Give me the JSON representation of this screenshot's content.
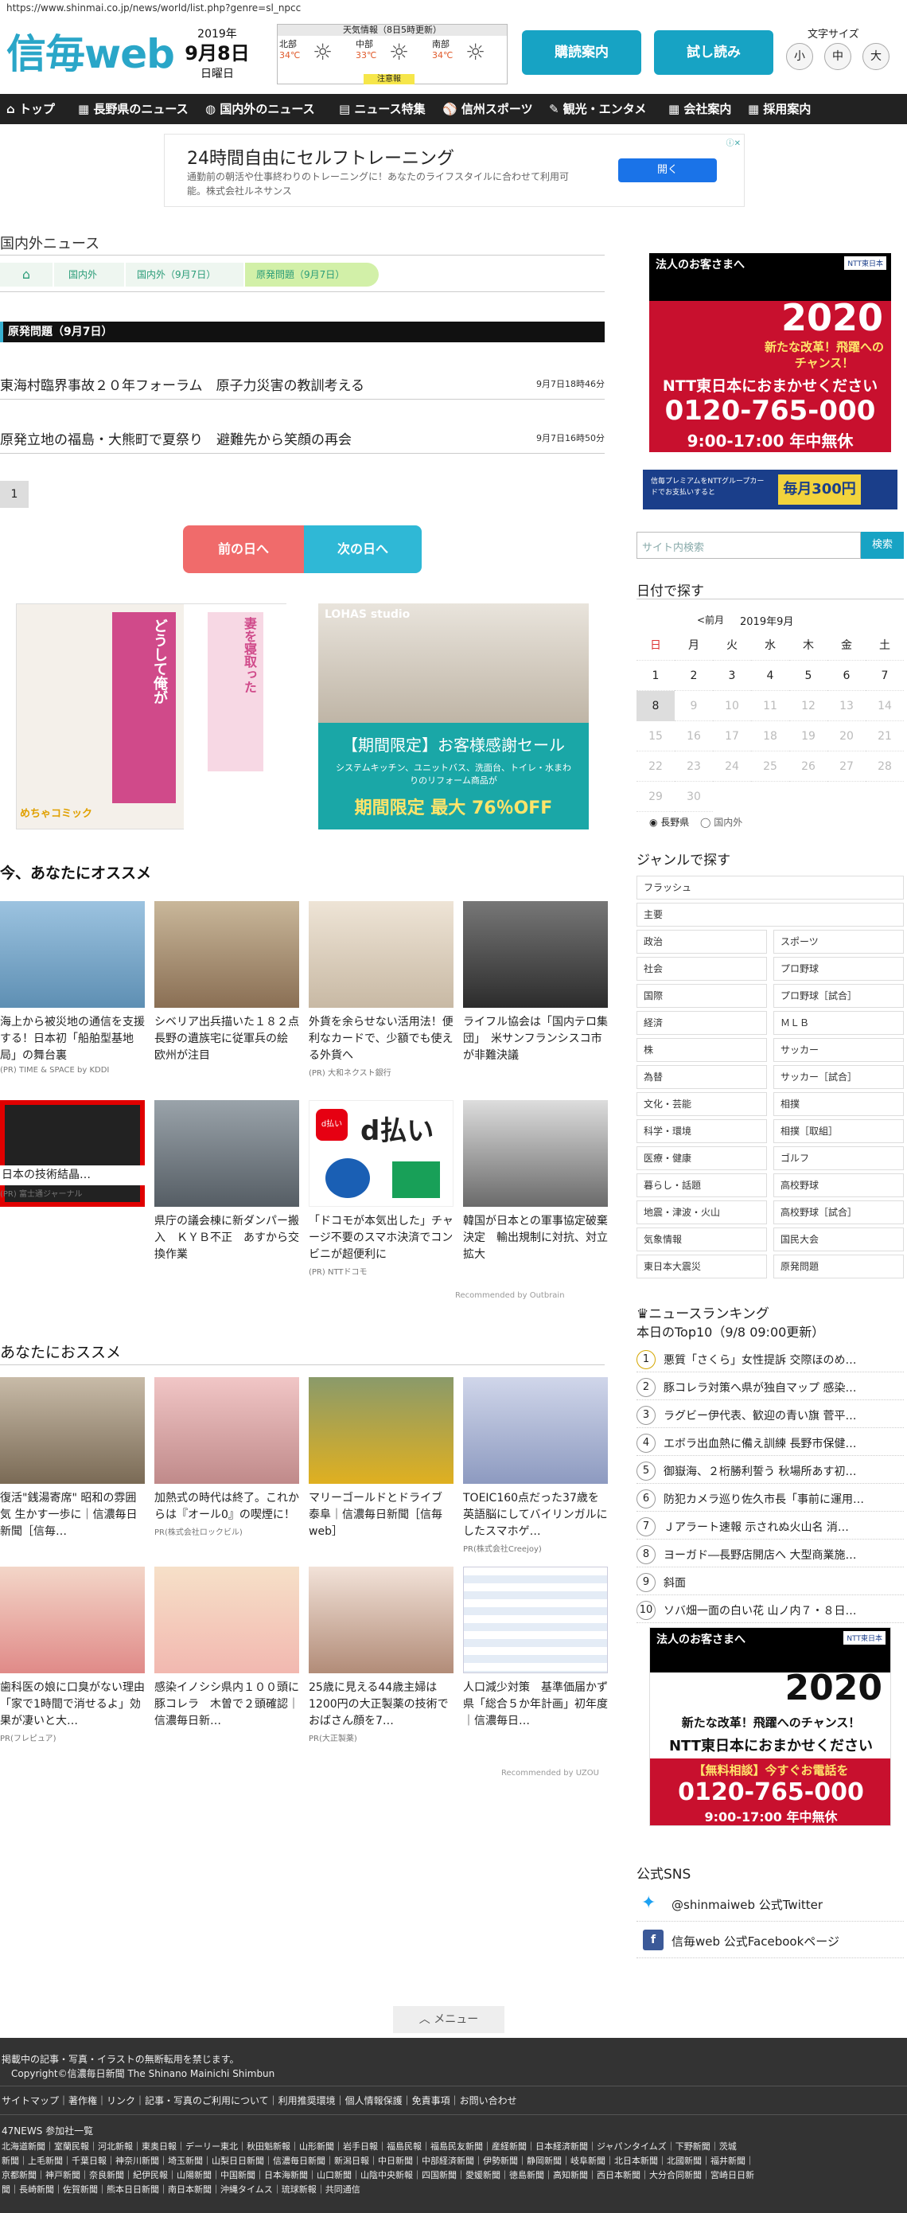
{
  "url": "https://www.shinmai.co.jp/news/world/list.php?genre=sl_npcc",
  "logo": "信毎web",
  "date": {
    "year": "2019年",
    "md": "9月8日",
    "wday": "日曜日"
  },
  "weather": {
    "title": "天気情報（8日5時更新）",
    "regions": [
      {
        "name": "北部",
        "temp": "34℃"
      },
      {
        "name": "中部",
        "temp": "33℃"
      },
      {
        "name": "南部",
        "temp": "34℃"
      }
    ],
    "warning": "注意報"
  },
  "header": {
    "subscribe": "購読案内",
    "trial": "試し読み",
    "font_size_label": "文字サイズ",
    "sizes": [
      "小",
      "中",
      "大"
    ]
  },
  "nav": [
    "トップ",
    "長野県のニュース",
    "国内外のニュース",
    "ニュース特集",
    "信州スポーツ",
    "観光・エンタメ",
    "会社案内",
    "採用案内"
  ],
  "ad_top": {
    "headline": "24時間自由にセルフトレーニング",
    "text": "通勤前の朝活や仕事終わりのトレーニングに！あなたのライフスタイルに合わせて利用可能。株式会社ルネサンス",
    "button": "開く"
  },
  "section_title": "国内外ニュース",
  "breadcrumb": [
    "国内外",
    "国内外（9月7日）",
    "原発問題（9月7日）"
  ],
  "list_title": "原発問題（9月7日）",
  "news": [
    {
      "title": "東海村臨界事故２０年フォーラム　原子力災害の教訓考える",
      "date": "9月7日18時46分"
    },
    {
      "title": "原発立地の福島・大熊町で夏祭り　避難先から笑顔の再会",
      "date": "9月7日16時50分"
    }
  ],
  "pager": "1",
  "prev_day": "前の日へ",
  "next_day": "次の日へ",
  "ads_mid": {
    "manga_brand": "めちゃコミック",
    "lohas_brand": "LOHAS studio",
    "lohas_title": "【期間限定】お客様感謝セール",
    "lohas_sub": "システムキッチン、ユニットバス、洗面台、トイレ・水まわりのリフォーム商品が",
    "lohas_off": "期間限定 最大 76％OFF"
  },
  "rec1_title": "今、あなたにオススメ",
  "rec1": [
    {
      "t": "海上から被災地の通信を支援する！日本初「船舶型基地局」の舞台裏",
      "pr": "(PR) TIME & SPACE by KDDI"
    },
    {
      "t": "シベリア出兵描いた１８２点　長野の遺族宅に従軍兵の絵　欧州が注目",
      "pr": ""
    },
    {
      "t": "外貨を余らせない活用法！便利なカードで、少額でも使える外貨へ",
      "pr": "(PR) 大和ネクスト銀行"
    },
    {
      "t": "ライフル協会は「国内テロ集団」　米サンフランシスコ市が非難決議",
      "pr": ""
    },
    {
      "t": "日本の技術結晶…",
      "pr": "(PR) 富士通ジャーナル"
    },
    {
      "t": "県庁の議会棟に新ダンパー搬入　ＫＹＢ不正　あすから交換作業",
      "pr": ""
    },
    {
      "t": "「ドコモが本気出した」チャージ不要のスマホ決済でコンビニが超便利に",
      "pr": "(PR) NTTドコモ"
    },
    {
      "t": "韓国が日本との軍事協定破棄決定　輸出規制に対抗、対立拡大",
      "pr": ""
    }
  ],
  "rec1_by": "Recommended by Outbrain",
  "rec2_title": "あなたにおススメ",
  "rec2": [
    {
      "t": "復活\"銭湯寄席\" 昭和の雰囲気 生かす一歩に｜信濃毎日新聞［信毎…",
      "pr": ""
    },
    {
      "t": "加熱式の時代は終了。これからは『オール0』の喫煙に！",
      "pr": "PR(株式会社ロックビル)"
    },
    {
      "t": "マリーゴールドとドライブ　泰阜｜信濃毎日新聞［信毎web］",
      "pr": ""
    },
    {
      "t": "TOEIC160点だった37歳を英語脳にしてバイリンガルにしたスマホゲ…",
      "pr": "PR(株式会社Creejoy)"
    },
    {
      "t": "歯科医の娘に口臭がない理由「家で1時間で消せるよ」効果が凄いと大…",
      "pr": "PR(フレピュア)"
    },
    {
      "t": "感染イノシシ県内１００頭に　豚コレラ　木曽で２頭確認｜信濃毎日新…",
      "pr": ""
    },
    {
      "t": "25歳に見える44歳主婦は1200円の大正製薬の技術でおばさん顔を7…",
      "pr": "PR(大正製薬)"
    },
    {
      "t": "人口減少対策　基準価届かず　県「総合５か年計画」初年度｜信濃毎日…",
      "pr": ""
    }
  ],
  "rec2_by": "Recommended by UZOU",
  "side": {
    "search_placeholder": "サイト内検索",
    "search_btn": "検索",
    "date_title": "日付で探す",
    "cal_prev": "<前月",
    "cal_month": "2019年9月",
    "weekdays": [
      "日",
      "月",
      "火",
      "水",
      "木",
      "金",
      "土"
    ],
    "days": [
      [
        1,
        2,
        3,
        4,
        5,
        6,
        7
      ],
      [
        8,
        9,
        10,
        11,
        12,
        13,
        14
      ],
      [
        15,
        16,
        17,
        18,
        19,
        20,
        21
      ],
      [
        22,
        23,
        24,
        25,
        26,
        27,
        28
      ],
      [
        29,
        30
      ]
    ],
    "radio1": "長野県",
    "radio2": "国内外",
    "genre_title": "ジャンルで探す",
    "genres": [
      "フラッシュ",
      "主要",
      "政治",
      "スポーツ",
      "社会",
      "プロ野球",
      "国際",
      "プロ野球［試合］",
      "経済",
      "ＭＬＢ",
      "株",
      "サッカー",
      "為替",
      "サッカー［試合］",
      "文化・芸能",
      "相撲",
      "科学・環境",
      "相撲［取組］",
      "医療・健康",
      "ゴルフ",
      "暮らし・話題",
      "高校野球",
      "地震・津波・火山",
      "高校野球［試合］",
      "気象情報",
      "国民大会",
      "東日本大震災",
      "原発問題"
    ],
    "rank_title": "ニュースランキング",
    "rank_sub": "本日のTop10（9/8 09:00更新）",
    "ranking": [
      "悪質「さくら」女性提訴 交際ほのめ…",
      "豚コレラ対策へ県が独自マップ 感染…",
      "ラグビー伊代表、歓迎の青い旗 菅平…",
      "エボラ出血熱に備え訓練 長野市保健…",
      "御嶽海、２桁勝利誓う 秋場所あす初…",
      "防犯カメラ巡り佐久市長「事前に運用…",
      "Ｊアラート速報 示されぬ火山名 消…",
      "ヨーガド―長野店開店へ 大型商業施…",
      "斜面",
      "ソバ畑一面の白い花 山ノ内７・８日…"
    ],
    "ad_brand": "NTT東日本",
    "ad_line1": "法人のお客さまへ",
    "ad_year": "2020",
    "ad_line2": "新たな改革！飛躍へのチャンス！",
    "ad_line3": "NTT東日本におまかせください",
    "ad_phone": "0120-765-000",
    "ad_hours": "9:00-17:00 年中無休",
    "ad2_text": "信毎プレミアムをNTTグループカードでお支払いすると",
    "ad2_big": "毎月300円",
    "ad_consult": "【無料相談】今すぐお電話を",
    "sns_title": "公式SNS",
    "twitter": "@shinmaiweb 公式Twitter",
    "facebook": "信毎web 公式Facebookページ"
  },
  "menu": "メニュー",
  "footer": {
    "copy1": "掲載中の記事・写真・イラストの無断転用を禁じます。",
    "copy2": "Copyright©信濃毎日新聞 The Shinano Mainichi Shimbun",
    "links": "サイトマップ｜著作権｜リンク｜記事・写真のご利用について｜利用推奨環境｜個人情報保護｜免責事項｜お問い合わせ",
    "partner_title": "47NEWS 参加社一覧",
    "partners1": "北海道新聞｜室蘭民報｜河北新報｜東奥日報｜デーリー東北｜秋田魁新報｜山形新聞｜岩手日報｜福島民報｜福島民友新聞｜産経新聞｜日本経済新聞｜ジャパンタイムズ｜下野新聞｜茨城",
    "partners2": "新聞｜上毛新聞｜千葉日報｜神奈川新聞｜埼玉新聞｜山梨日日新聞｜信濃毎日新聞｜新潟日報｜中日新聞｜中部経済新聞｜伊勢新聞｜静岡新聞｜岐阜新聞｜北日本新聞｜北國新聞｜福井新聞｜",
    "partners3": "京都新聞｜神戸新聞｜奈良新聞｜紀伊民報｜山陽新聞｜中国新聞｜日本海新聞｜山口新聞｜山陰中央新報｜四国新聞｜愛媛新聞｜徳島新聞｜高知新聞｜西日本新聞｜大分合同新聞｜宮崎日日新",
    "partners4": "聞｜長崎新聞｜佐賀新聞｜熊本日日新聞｜南日本新聞｜沖縄タイムス｜琉球新報｜共同通信"
  }
}
